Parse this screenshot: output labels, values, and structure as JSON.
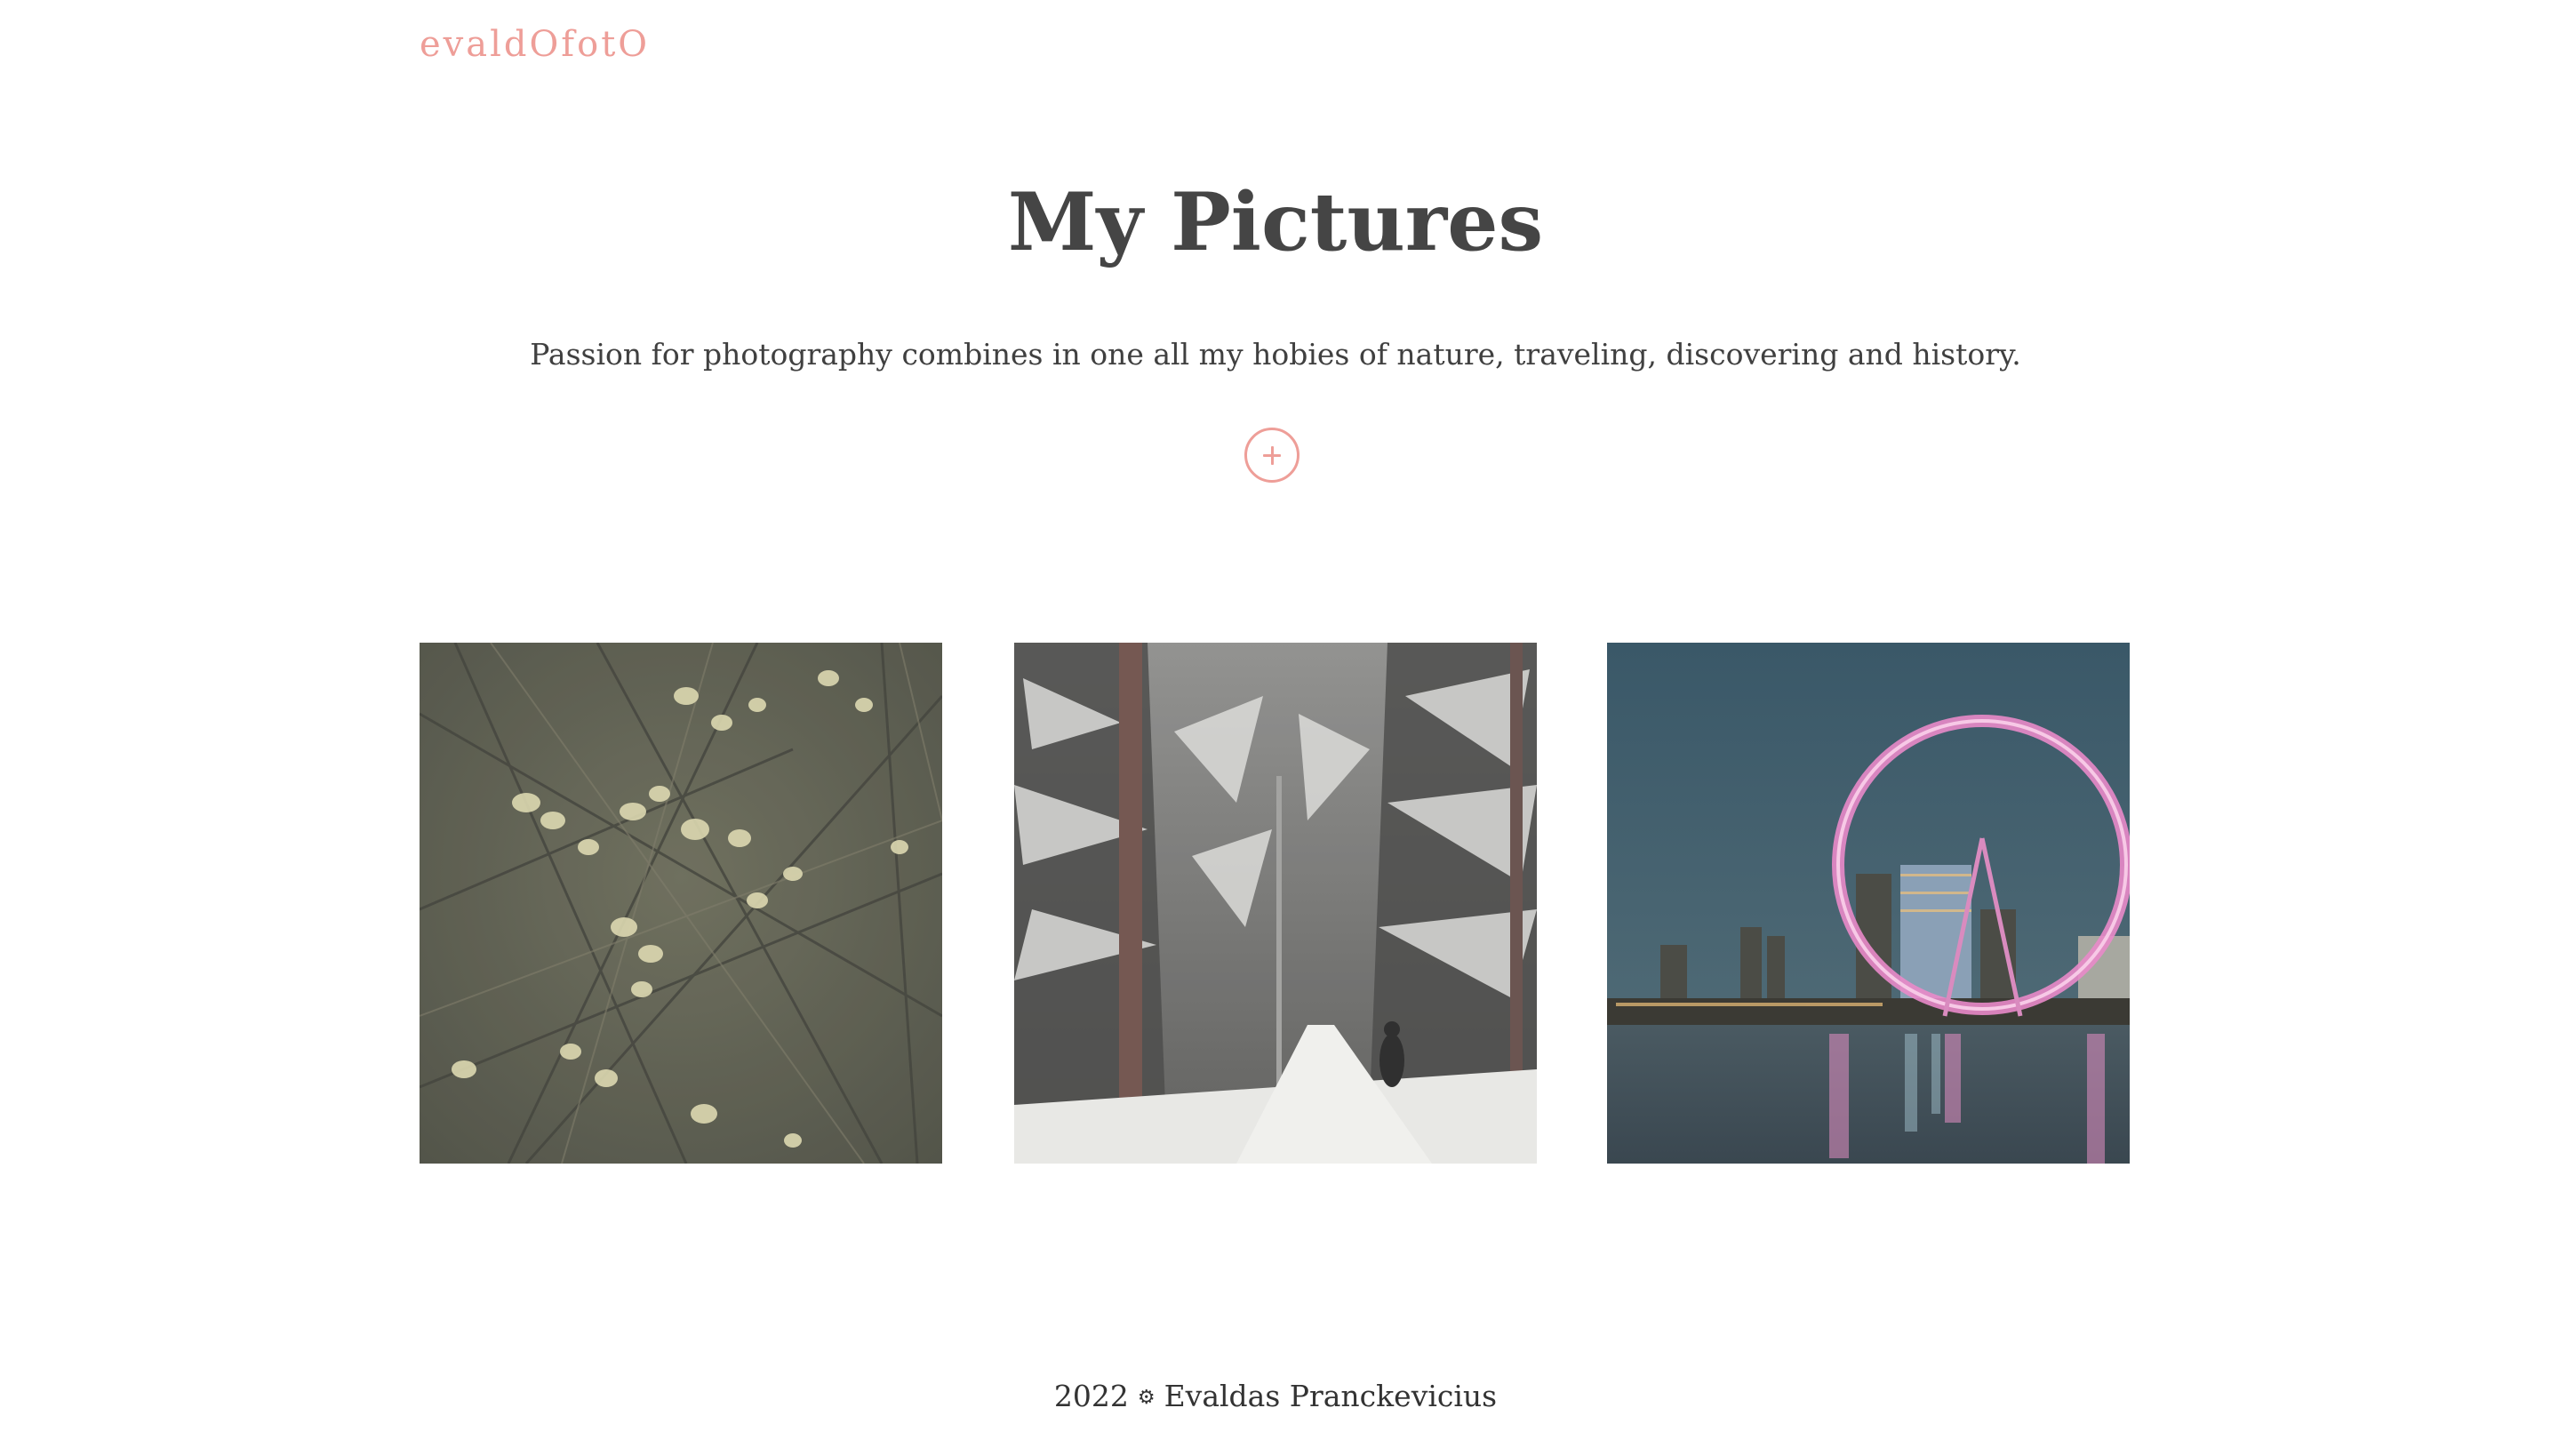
{
  "header": {
    "logo_text": "evaldOfotO"
  },
  "hero": {
    "title": "My Pictures",
    "tagline": "Passion for photography combines in one all my hobies of nature, traveling, discovering and history.",
    "expand_icon": "plus-circle-icon"
  },
  "gallery": {
    "items": [
      {
        "subject": "willow-catkins-photo"
      },
      {
        "subject": "snowy-forest-path-photo"
      },
      {
        "subject": "london-eye-night-photo"
      }
    ]
  },
  "footer": {
    "year": "2022",
    "separator": "⚙",
    "author": "Evaldas Pranckevicius"
  },
  "colors": {
    "accent": "#ee9e98",
    "title": "#454545",
    "text": "#404040",
    "background": "#ffffff"
  }
}
